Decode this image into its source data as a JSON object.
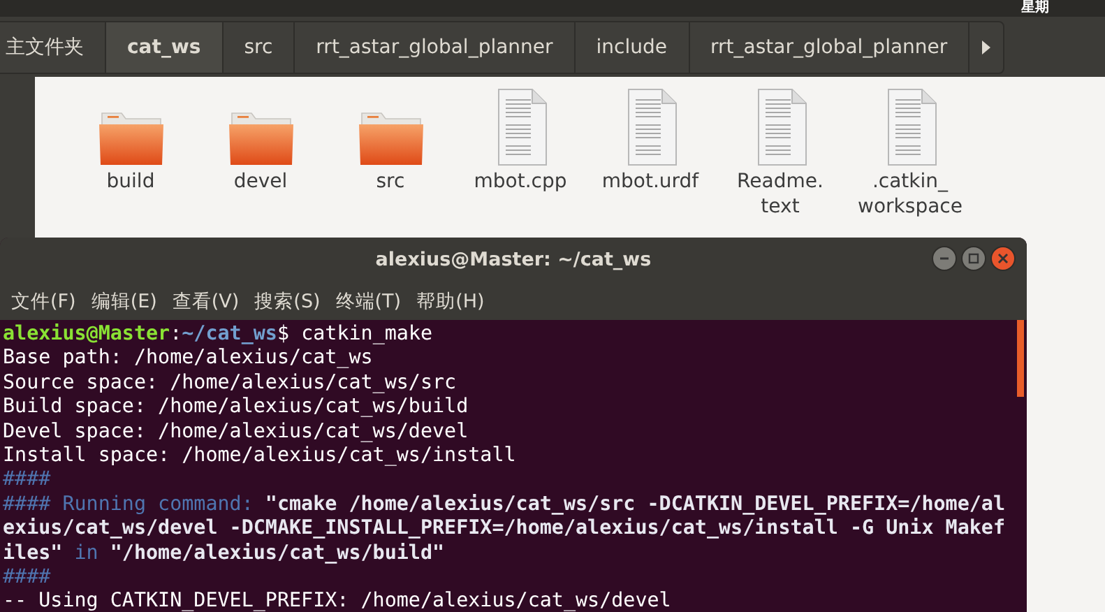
{
  "top_bar": {
    "clock": "星期"
  },
  "path_bar": {
    "items": [
      {
        "label": "主文件夹",
        "selected": false
      },
      {
        "label": "cat_ws",
        "selected": true
      },
      {
        "label": "src",
        "selected": false
      },
      {
        "label": "rrt_astar_global_planner",
        "selected": false
      },
      {
        "label": "include",
        "selected": false
      },
      {
        "label": "rrt_astar_global_planner",
        "selected": false
      }
    ]
  },
  "files": [
    {
      "name": "build",
      "kind": "folder"
    },
    {
      "name": "devel",
      "kind": "folder"
    },
    {
      "name": "src",
      "kind": "folder"
    },
    {
      "name": "mbot.cpp",
      "kind": "document"
    },
    {
      "name": "mbot.urdf",
      "kind": "document"
    },
    {
      "name": "Readme.\ntext",
      "kind": "document"
    },
    {
      "name": ".catkin_\nworkspace",
      "kind": "document"
    }
  ],
  "terminal": {
    "title": "alexius@Master: ~/cat_ws",
    "menu": [
      "文件(F)",
      "编辑(E)",
      "查看(V)",
      "搜索(S)",
      "终端(T)",
      "帮助(H)"
    ],
    "lines": [
      [
        {
          "text": "alexius@Master",
          "kind": "user"
        },
        {
          "text": ":",
          "kind": "plain"
        },
        {
          "text": "~/cat_ws",
          "kind": "path"
        },
        {
          "text": "$ catkin_make",
          "kind": "plain"
        }
      ],
      [
        {
          "text": "Base path: /home/alexius/cat_ws",
          "kind": "plain"
        }
      ],
      [
        {
          "text": "Source space: /home/alexius/cat_ws/src",
          "kind": "plain"
        }
      ],
      [
        {
          "text": "Build space: /home/alexius/cat_ws/build",
          "kind": "plain"
        }
      ],
      [
        {
          "text": "Devel space: /home/alexius/cat_ws/devel",
          "kind": "plain"
        }
      ],
      [
        {
          "text": "Install space: /home/alexius/cat_ws/install",
          "kind": "plain"
        }
      ],
      [
        {
          "text": "####",
          "kind": "dim"
        }
      ],
      [
        {
          "text": "#### Running command: ",
          "kind": "dim"
        },
        {
          "text": "\"cmake /home/alexius/cat_ws/src -DCATKIN_DEVEL_PREFIX=/home/alexius/cat_ws/devel -DCMAKE_INSTALL_PREFIX=/home/alexius/cat_ws/install -G Unix Makefiles\"",
          "kind": "bold"
        },
        {
          "text": " in ",
          "kind": "dim"
        },
        {
          "text": "\"/home/alexius/cat_ws/build\"",
          "kind": "bold"
        }
      ],
      [
        {
          "text": "####",
          "kind": "dim"
        }
      ],
      [
        {
          "text": "-- Using CATKIN_DEVEL_PREFIX: /home/alexius/cat_ws/devel",
          "kind": "plain"
        }
      ]
    ]
  }
}
